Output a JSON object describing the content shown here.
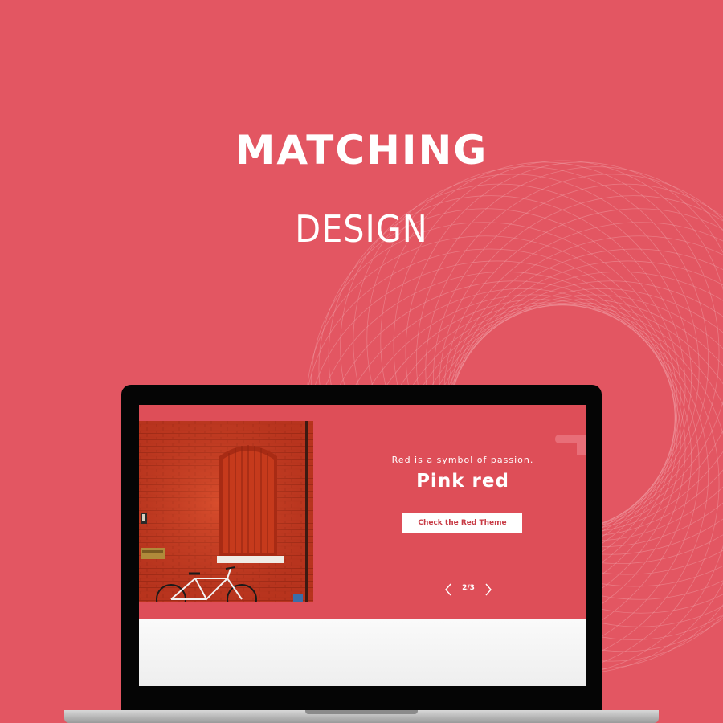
{
  "headline": {
    "line1": "MATCHING",
    "line2": "DESIGN"
  },
  "hero": {
    "tagline": "Red is a symbol of passion.",
    "title": "Pink red",
    "cta_label": "Check the Red Theme",
    "pager": {
      "current": 2,
      "total": 3,
      "label": "2/3"
    },
    "photo_icon": "red-brick-wall-photo"
  },
  "colors": {
    "background": "#e35662",
    "hero": "#de4e58",
    "button_text": "#c73a44",
    "text": "#ffffff"
  },
  "icons": {
    "prev": "chevron-left-icon",
    "next": "chevron-right-icon"
  }
}
